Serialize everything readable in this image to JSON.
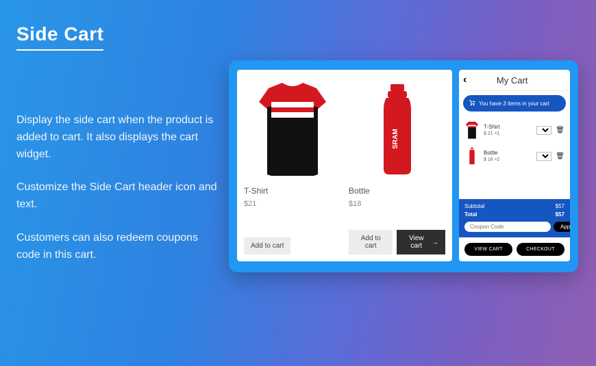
{
  "page": {
    "title": "Side Cart",
    "paragraphs": [
      "Display the side cart when the product is added to cart. It also displays the cart widget.",
      "Customize the Side Cart header icon and text.",
      "Customers can also redeem coupons code in this cart."
    ]
  },
  "products": [
    {
      "name": "T-Shirt",
      "price": "$21",
      "add_label": "Add to cart"
    },
    {
      "name": "Bottle",
      "price": "$18",
      "add_label": "Add to cart",
      "view_label": "View cart"
    }
  ],
  "cart": {
    "title": "My Cart",
    "banner": "You have 3 items in your cart",
    "items": [
      {
        "name": "T-Shirt",
        "price_line": "$ 21 ×1",
        "qty": "1"
      },
      {
        "name": "Bottle",
        "price_line": "$ 18 ×2",
        "qty": "2"
      }
    ],
    "subtotal_label": "Subtotal",
    "subtotal_value": "$57",
    "total_label": "Total",
    "total_value": "$57",
    "coupon_placeholder": "Coupon Code",
    "apply_label": "Apply",
    "view_cart_label": "VIEW CART",
    "checkout_label": "CHECKOUT"
  }
}
